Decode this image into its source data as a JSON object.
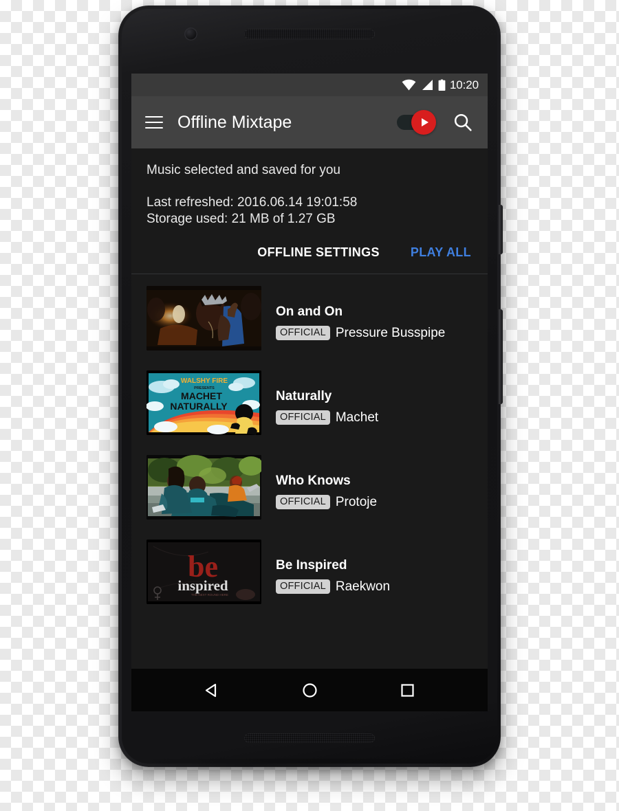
{
  "device": {
    "type": "android-smartphone",
    "camera_icon": "front-camera",
    "earpiece_icon": "earpiece-grille",
    "speaker_icon": "bottom-speaker-grille",
    "power_button": "power-button",
    "volume_button": "volume-rocker"
  },
  "status_bar": {
    "wifi_icon": "wifi-icon",
    "signal_icon": "cellular-signal-icon",
    "battery_icon": "battery-full-icon",
    "clock": "10:20",
    "background": "#3a3a3a"
  },
  "app_bar": {
    "menu_icon": "hamburger-menu-icon",
    "title": "Offline Mixtape",
    "toggle": {
      "name": "music-mode-toggle",
      "state": "on",
      "thumb_icon": "play-triangle-icon",
      "thumb_color": "#d81e1e",
      "track_color": "#1e2526"
    },
    "search_icon": "search-icon",
    "background": "#424242"
  },
  "info": {
    "subtitle": "Music selected and saved for you",
    "last_refreshed": "Last refreshed: 2016.06.14 19:01:58",
    "storage_used": "Storage used: 21 MB of 1.27 GB"
  },
  "actions": {
    "offline_settings_label": "OFFLINE SETTINGS",
    "play_all_label": "PLAY ALL",
    "play_all_color": "#3f7fe0"
  },
  "videos": [
    {
      "title": "On and On",
      "badge": "OFFICIAL",
      "artist": "Pressure Busspipe",
      "thumbnail": "night-concert-hand-photo"
    },
    {
      "title": "Naturally",
      "badge": "OFFICIAL",
      "artist": "Machet",
      "thumbnail": "walshy-fire-machet-naturally-rainbow-artwork"
    },
    {
      "title": "Who Knows",
      "badge": "OFFICIAL",
      "artist": "Protoje",
      "thumbnail": "riders-on-teal-motorcycle-photo"
    },
    {
      "title": "Be Inspired",
      "badge": "OFFICIAL",
      "artist": "Raekwon",
      "thumbnail": "be-inspired-red-blackletter-artwork"
    }
  ],
  "nav_bar": {
    "back_icon": "back-triangle-icon",
    "home_icon": "home-circle-icon",
    "recents_icon": "recents-square-icon",
    "background": "#070707"
  },
  "theme": {
    "screen_background": "#1a1a1a",
    "text_primary": "#ffffff",
    "badge_background": "#d2d2d2"
  }
}
